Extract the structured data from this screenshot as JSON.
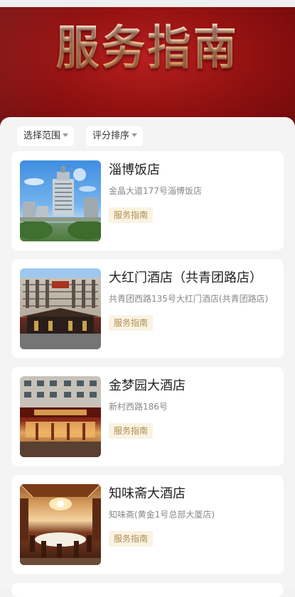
{
  "banner": {
    "title": "服务指南"
  },
  "filters": [
    {
      "label": "选择范围"
    },
    {
      "label": "评分排序"
    }
  ],
  "hotels": [
    {
      "name": "淄博饭店",
      "address": "金晶大道177号淄博饭店",
      "tag": "服务指南"
    },
    {
      "name": "大红门酒店（共青团路店）",
      "address": "共青团西路135号大红门酒店(共青团路店)",
      "tag": "服务指南"
    },
    {
      "name": "金梦园大酒店",
      "address": "新村西路186号",
      "tag": "服务指南"
    },
    {
      "name": "知味斋大酒店",
      "address": "知味斋(黄金1号总部大厦店)",
      "tag": "服务指南"
    }
  ]
}
